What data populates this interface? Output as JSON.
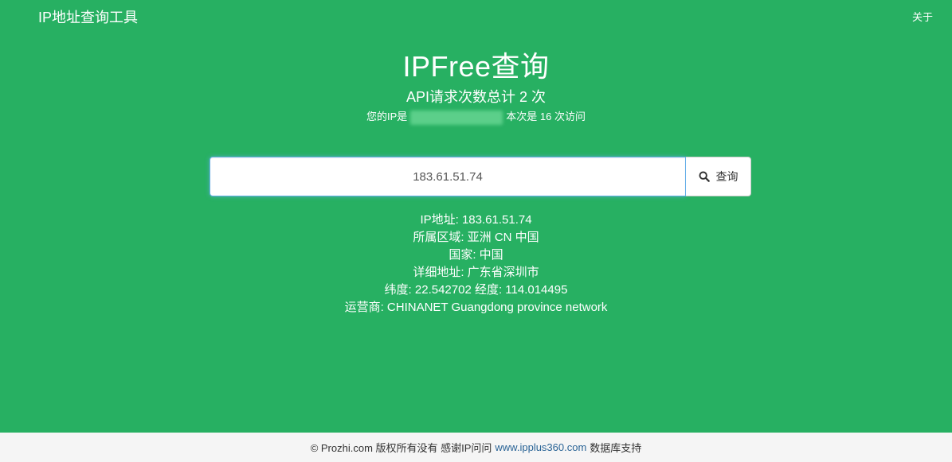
{
  "nav": {
    "brand": "IP地址查询工具",
    "about": "关于"
  },
  "hero": {
    "title": "IPFree查询",
    "subtitle": "API请求次数总计 2 次",
    "visit_prefix": "您的IP是",
    "visit_suffix": "本次是 16 次访问"
  },
  "search": {
    "value": "183.61.51.74",
    "button_label": "查询"
  },
  "results": [
    "IP地址: 183.61.51.74",
    "所属区域: 亚洲 CN 中国",
    "国家: 中国",
    "详细地址: 广东省深圳市",
    "纬度: 22.542702 经度: 114.014495",
    "运营商: CHINANET Guangdong province network"
  ],
  "footer": {
    "prefix": "© Prozhi.com 版权所有没有 感谢IP问问",
    "link": "www.ipplus360.com",
    "suffix": "数据库支持"
  },
  "colors": {
    "background": "#27b062",
    "footer_bg": "#f5f5f5",
    "link": "#2a6496"
  },
  "icons": {
    "search": "search-icon"
  }
}
